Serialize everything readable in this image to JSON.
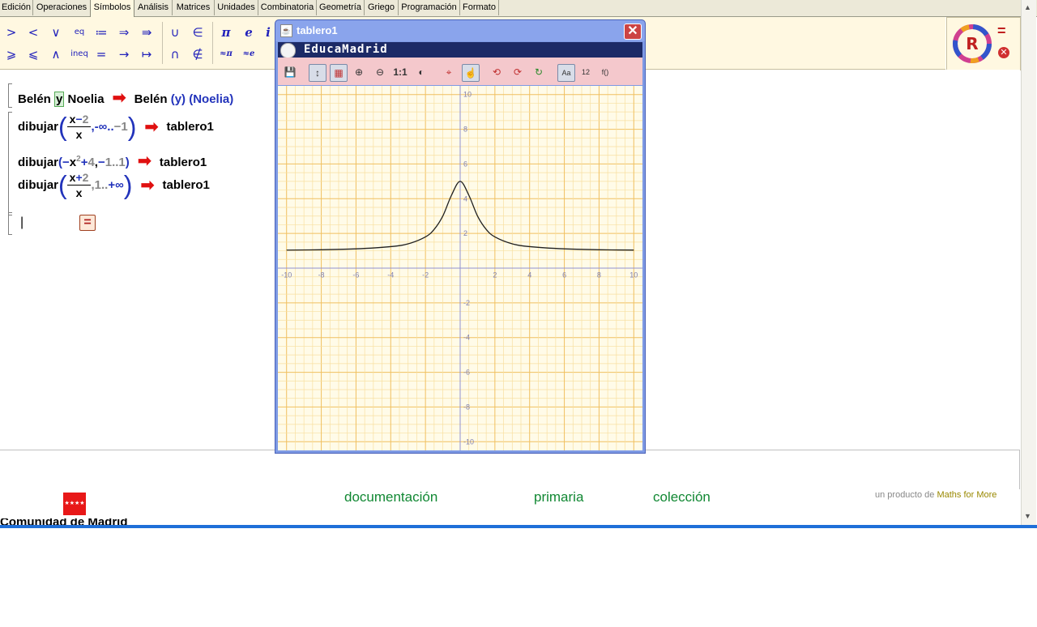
{
  "tabs": [
    "Edición",
    "Operaciones",
    "Símbolos",
    "Análisis",
    "Matrices",
    "Unidades",
    "Combinatoria",
    "Geometría",
    "Griego",
    "Programación",
    "Formato"
  ],
  "active_tab": "Símbolos",
  "symbols": {
    "row1": [
      ">",
      "<",
      "∨",
      "eq",
      "≔",
      "⇒",
      "⇛",
      "∪",
      "∈",
      "π",
      "e",
      "i"
    ],
    "row2": [
      "⩾",
      "⩽",
      "∧",
      "ineq",
      "=",
      "→",
      "↦",
      "∩",
      "∉",
      "≈π",
      "≈e"
    ]
  },
  "right_panel": {
    "equals": "=",
    "cancel": "⊗"
  },
  "worksheet": {
    "line1": {
      "a": "Belén",
      "y": "y",
      "b": "Noelia",
      "arrow": "➡",
      "r1": "Belén",
      "r2": "(y)",
      "r3": "(Noelia)"
    },
    "line2": {
      "fn": "dibujar",
      "num_x": "x",
      "num_minus": "−",
      "num_2": "2",
      "den": "x",
      "range_a": ",-∞..",
      "range_b": "−1",
      "arrow": "➡",
      "target": "tablero1"
    },
    "line3": {
      "fn": "dibujar",
      "p_open": "(",
      "minus": "−",
      "x": "x",
      "exp": "2",
      "plus": "+",
      "four": "4",
      "comma": ",",
      "neg": "−",
      "one": "1..1",
      "p_close": ")",
      "arrow": "➡",
      "target": "tablero1"
    },
    "line4": {
      "fn": "dibujar",
      "num_x": "x",
      "num_plus": "+",
      "num_2": "2",
      "den": "x",
      "range_a": ",1..",
      "range_b": "+∞",
      "arrow": "➡",
      "target": "tablero1"
    },
    "cursor": "|",
    "eval_button": "="
  },
  "footer": {
    "links": [
      "documentación",
      "primaria",
      "colección"
    ],
    "credit_prefix": "un producto de ",
    "credit_brand": "Maths for More",
    "left_text": "Comunidad de Madrid"
  },
  "graph_window": {
    "title": "tablero1",
    "brand": "EducaMadrid",
    "close": "✕",
    "tools": [
      "💾",
      "↕",
      "▦",
      "⊕",
      "⊖",
      "1:1",
      "◐",
      "⌖",
      "☝",
      "⟲",
      "⟳",
      "↻",
      "Aa",
      "12",
      "f()"
    ],
    "x_ticks": [
      "-10",
      "-8",
      "-6",
      "-4",
      "-2",
      "2",
      "4",
      "6",
      "8",
      "10"
    ],
    "y_ticks": [
      "10",
      "8",
      "6",
      "4",
      "2",
      "-2",
      "-4",
      "-6",
      "-8",
      "-10"
    ]
  },
  "chart_data": {
    "type": "line",
    "function": "4/(1+x^2) + 1",
    "xlim": [
      -10.5,
      10.5
    ],
    "ylim": [
      -10.5,
      10.5
    ],
    "grid": true,
    "x": [
      -10,
      -8,
      -6,
      -4,
      -3,
      -2,
      -1.5,
      -1,
      -0.5,
      0,
      0.5,
      1,
      1.5,
      2,
      3,
      4,
      6,
      8,
      10
    ],
    "y": [
      1.04,
      1.06,
      1.11,
      1.24,
      1.4,
      1.8,
      2.23,
      3.0,
      4.2,
      5.0,
      4.2,
      3.0,
      2.23,
      1.8,
      1.4,
      1.24,
      1.11,
      1.06,
      1.04
    ]
  }
}
